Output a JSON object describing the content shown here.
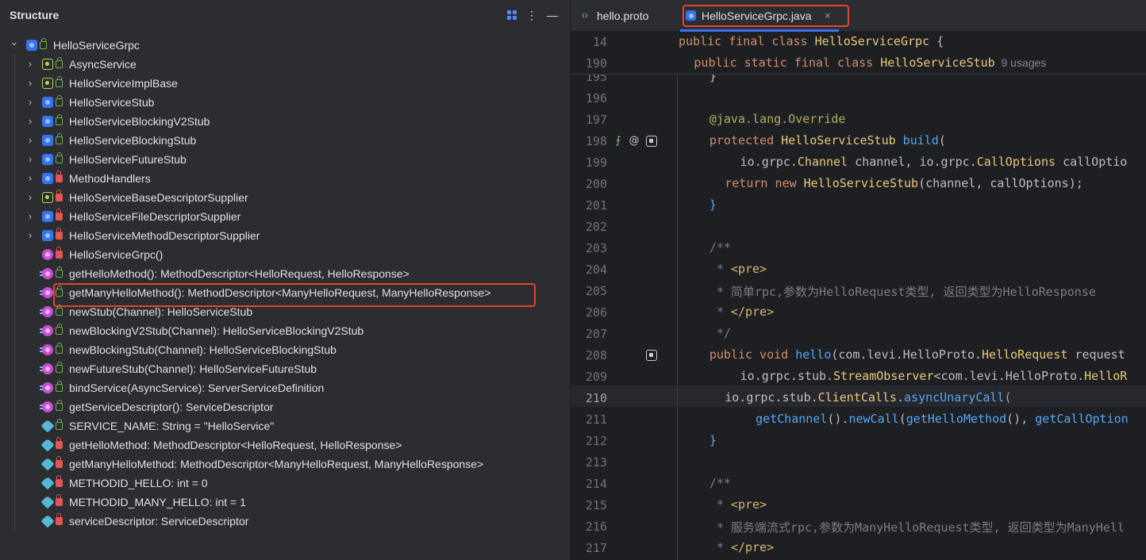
{
  "structure": {
    "title": "Structure",
    "icons": [
      "grid-view-icon",
      "more-options-icon",
      "minimize-icon"
    ],
    "root": {
      "label": "HelloServiceGrpc",
      "icon": "class-icon",
      "visibility": "public",
      "expanded": true
    },
    "items": [
      {
        "label": "AsyncService",
        "icon": "interface-icon",
        "visibility": "public",
        "expandable": true
      },
      {
        "label": "HelloServiceImplBase",
        "icon": "abstract-class-icon",
        "visibility": "public",
        "expandable": true
      },
      {
        "label": "HelloServiceStub",
        "icon": "class-icon",
        "visibility": "public",
        "expandable": true
      },
      {
        "label": "HelloServiceBlockingV2Stub",
        "icon": "class-icon",
        "visibility": "public",
        "expandable": true
      },
      {
        "label": "HelloServiceBlockingStub",
        "icon": "class-icon",
        "visibility": "public",
        "expandable": true
      },
      {
        "label": "HelloServiceFutureStub",
        "icon": "class-icon",
        "visibility": "public",
        "expandable": true
      },
      {
        "label": "MethodHandlers",
        "icon": "class-icon",
        "visibility": "private",
        "expandable": true
      },
      {
        "label": "HelloServiceBaseDescriptorSupplier",
        "icon": "abstract-class-icon",
        "visibility": "private",
        "expandable": true
      },
      {
        "label": "HelloServiceFileDescriptorSupplier",
        "icon": "class-icon",
        "visibility": "private",
        "expandable": true
      },
      {
        "label": "HelloServiceMethodDescriptorSupplier",
        "icon": "class-icon",
        "visibility": "private",
        "expandable": true
      },
      {
        "label": "HelloServiceGrpc()",
        "icon": "method-icon",
        "visibility": "private",
        "expandable": false
      },
      {
        "label": "getHelloMethod(): MethodDescriptor<HelloRequest, HelloResponse>",
        "icon": "static-method-icon",
        "visibility": "public",
        "expandable": false
      },
      {
        "label": "getManyHelloMethod(): MethodDescriptor<ManyHelloRequest, ManyHelloResponse>",
        "icon": "static-method-icon",
        "visibility": "public",
        "expandable": false,
        "highlighted": true
      },
      {
        "label": "newStub(Channel): HelloServiceStub",
        "icon": "static-method-icon",
        "visibility": "public",
        "expandable": false
      },
      {
        "label": "newBlockingV2Stub(Channel): HelloServiceBlockingV2Stub",
        "icon": "static-method-icon",
        "visibility": "public",
        "expandable": false
      },
      {
        "label": "newBlockingStub(Channel): HelloServiceBlockingStub",
        "icon": "static-method-icon",
        "visibility": "public",
        "expandable": false
      },
      {
        "label": "newFutureStub(Channel): HelloServiceFutureStub",
        "icon": "static-method-icon",
        "visibility": "public",
        "expandable": false
      },
      {
        "label": "bindService(AsyncService): ServerServiceDefinition",
        "icon": "static-method-icon",
        "visibility": "public",
        "expandable": false
      },
      {
        "label": "getServiceDescriptor(): ServiceDescriptor",
        "icon": "static-method-icon",
        "visibility": "public",
        "expandable": false
      },
      {
        "label": "SERVICE_NAME: String = \"HelloService\"",
        "icon": "field-icon",
        "visibility": "public",
        "expandable": false
      },
      {
        "label": "getHelloMethod: MethodDescriptor<HelloRequest, HelloResponse>",
        "icon": "field-icon",
        "visibility": "private",
        "expandable": false
      },
      {
        "label": "getManyHelloMethod: MethodDescriptor<ManyHelloRequest, ManyHelloResponse>",
        "icon": "field-icon",
        "visibility": "private",
        "expandable": false
      },
      {
        "label": "METHODID_HELLO: int = 0",
        "icon": "field-icon",
        "visibility": "private",
        "expandable": false
      },
      {
        "label": "METHODID_MANY_HELLO: int = 1",
        "icon": "field-icon",
        "visibility": "private",
        "expandable": false
      },
      {
        "label": "serviceDescriptor: ServiceDescriptor",
        "icon": "field-icon",
        "visibility": "private",
        "expandable": false
      }
    ]
  },
  "editor": {
    "tabs": [
      {
        "label": "hello.proto",
        "icon": "proto-file-icon",
        "active": false
      },
      {
        "label": "HelloServiceGrpc.java",
        "icon": "java-class-icon",
        "active": true,
        "close": "×"
      }
    ],
    "sticky": [
      {
        "num": "14",
        "indent": 0,
        "parts": [
          [
            "kw",
            "public final class "
          ],
          [
            "cls",
            "HelloServiceGrpc"
          ],
          [
            "par",
            " {"
          ]
        ]
      },
      {
        "num": "190",
        "indent": 1,
        "parts": [
          [
            "kw",
            "public static final class "
          ],
          [
            "cls",
            "HelloServiceStub"
          ]
        ],
        "usage": "9 usages"
      }
    ],
    "lines": [
      {
        "num": "195",
        "indent": 2,
        "parts": [
          [
            "par",
            "}"
          ]
        ]
      },
      {
        "num": "196",
        "indent": 0,
        "parts": []
      },
      {
        "num": "197",
        "indent": 2,
        "parts": [
          [
            "ann",
            "@java.lang.Override"
          ]
        ]
      },
      {
        "num": "198",
        "indent": 2,
        "parts": [
          [
            "kw",
            "protected "
          ],
          [
            "cls",
            "HelloServiceStub "
          ],
          [
            "fn",
            "build"
          ],
          [
            "par",
            "("
          ]
        ]
      },
      {
        "num": "199",
        "indent": 4,
        "parts": [
          [
            "pkg",
            "io.grpc."
          ],
          [
            "cls",
            "Channel "
          ],
          [
            "par",
            "channel, "
          ],
          [
            "pkg",
            "io.grpc."
          ],
          [
            "cls",
            "CallOptions "
          ],
          [
            "par",
            "callOptio"
          ]
        ]
      },
      {
        "num": "200",
        "indent": 3,
        "parts": [
          [
            "kw",
            "return new "
          ],
          [
            "cls",
            "HelloServiceStub"
          ],
          [
            "par",
            "(channel, callOptions);"
          ]
        ]
      },
      {
        "num": "201",
        "indent": 2,
        "parts": [
          [
            "fn",
            "}"
          ]
        ]
      },
      {
        "num": "202",
        "indent": 0,
        "parts": []
      },
      {
        "num": "203",
        "indent": 2,
        "parts": [
          [
            "cm",
            "/**"
          ]
        ]
      },
      {
        "num": "204",
        "indent": 2,
        "parts": [
          [
            "cm",
            " * "
          ],
          [
            "tag",
            "<pre>"
          ]
        ]
      },
      {
        "num": "205",
        "indent": 2,
        "parts": [
          [
            "cm",
            " * 简单rpc,参数为HelloRequest类型, 返回类型为HelloResponse"
          ]
        ]
      },
      {
        "num": "206",
        "indent": 2,
        "parts": [
          [
            "cm",
            " * "
          ],
          [
            "tag",
            "</pre>"
          ]
        ]
      },
      {
        "num": "207",
        "indent": 2,
        "parts": [
          [
            "cm",
            " */"
          ]
        ]
      },
      {
        "num": "208",
        "indent": 2,
        "parts": [
          [
            "kw",
            "public void "
          ],
          [
            "fn",
            "hello"
          ],
          [
            "par",
            "(com.levi.HelloProto."
          ],
          [
            "cls",
            "HelloRequest "
          ],
          [
            "par",
            "request"
          ]
        ]
      },
      {
        "num": "209",
        "indent": 4,
        "parts": [
          [
            "pkg",
            "io.grpc.stub."
          ],
          [
            "cls",
            "StreamObserver"
          ],
          [
            "par",
            "<com.levi.HelloProto."
          ],
          [
            "cls",
            "HelloR"
          ]
        ]
      },
      {
        "num": "210",
        "indent": 3,
        "parts": [
          [
            "pkg",
            "io.grpc.stub."
          ],
          [
            "cls",
            "ClientCalls"
          ],
          [
            "par",
            "."
          ],
          [
            "fn",
            "asyncUnaryCall"
          ],
          [
            "ann",
            "("
          ]
        ]
      },
      {
        "num": "211",
        "indent": 5,
        "parts": [
          [
            "fn",
            "getChannel"
          ],
          [
            "par",
            "()."
          ],
          [
            "fn",
            "newCall"
          ],
          [
            "par",
            "("
          ],
          [
            "fn",
            "getHelloMethod"
          ],
          [
            "par",
            "(), "
          ],
          [
            "fn",
            "getCallOption"
          ]
        ]
      },
      {
        "num": "212",
        "indent": 2,
        "parts": [
          [
            "fn",
            "}"
          ]
        ]
      },
      {
        "num": "213",
        "indent": 0,
        "parts": []
      },
      {
        "num": "214",
        "indent": 2,
        "parts": [
          [
            "cm",
            "/**"
          ]
        ]
      },
      {
        "num": "215",
        "indent": 2,
        "parts": [
          [
            "cm",
            " * "
          ],
          [
            "tag",
            "<pre>"
          ]
        ]
      },
      {
        "num": "216",
        "indent": 2,
        "parts": [
          [
            "cm",
            " * 服务端流式rpc,参数为ManyHelloRequest类型, 返回类型为ManyHell"
          ]
        ]
      },
      {
        "num": "217",
        "indent": 2,
        "parts": [
          [
            "cm",
            " * "
          ],
          [
            "tag",
            "</pre>"
          ]
        ]
      }
    ],
    "current_line": "210",
    "gutter_icons": {
      "198": [
        "implements-icon",
        "annotation-icon",
        "override-icon"
      ],
      "208": [
        "override-icon"
      ]
    }
  }
}
